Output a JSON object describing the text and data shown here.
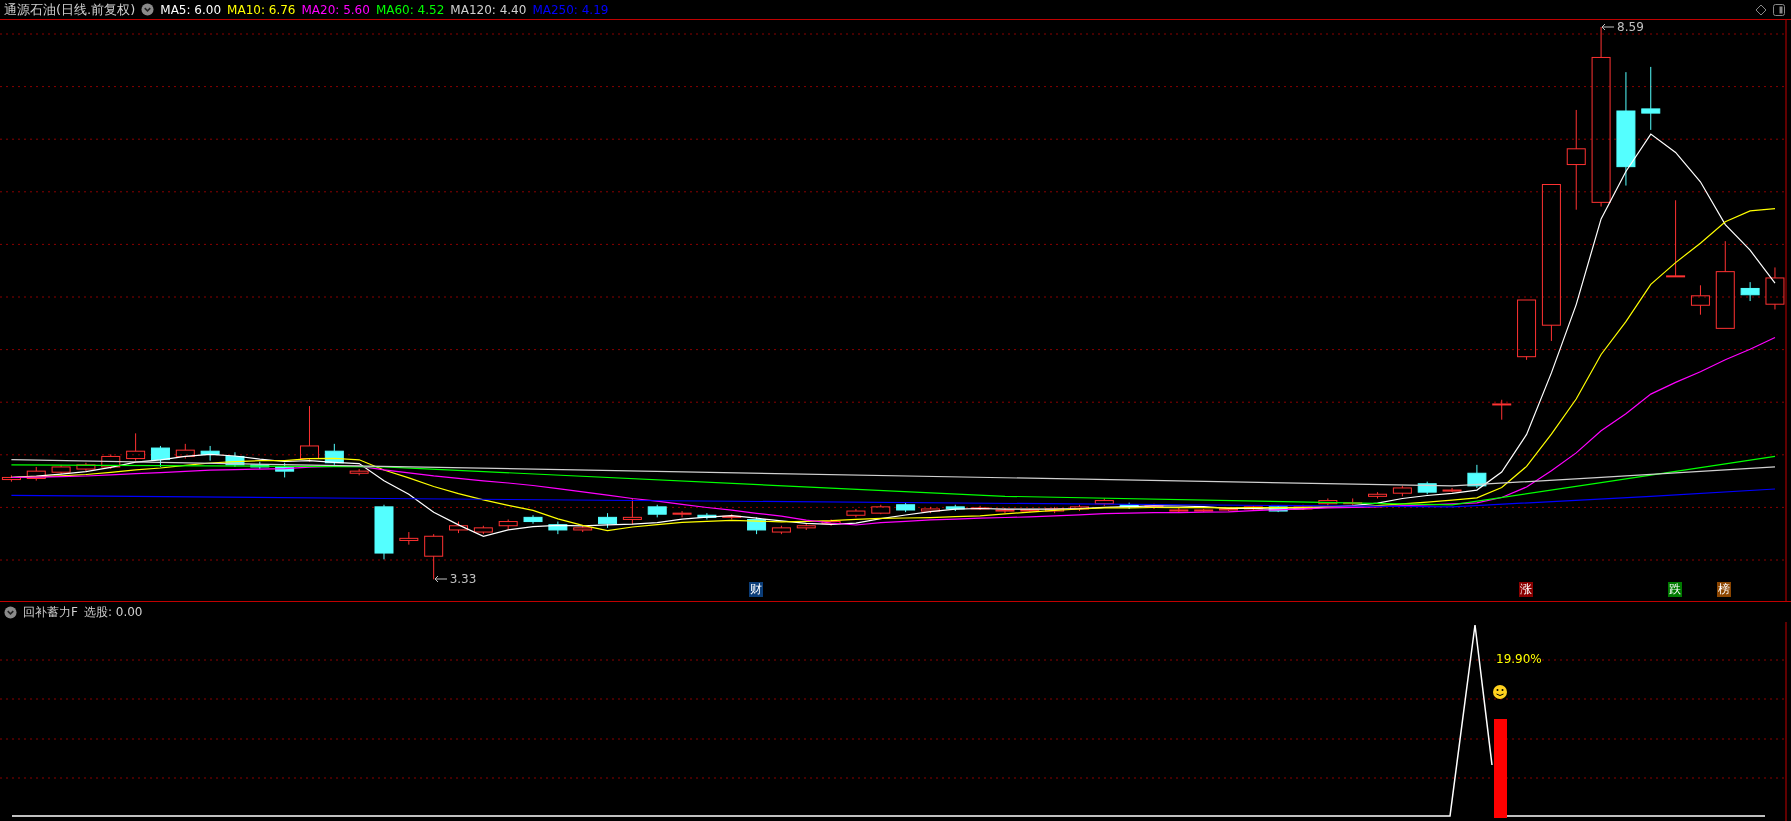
{
  "header": {
    "title": "通源石油(日线.前复权)",
    "ma_legend": [
      {
        "label": "MA5: 6.00",
        "color": "#ffffff"
      },
      {
        "label": "MA10: 6.76",
        "color": "#ffff00"
      },
      {
        "label": "MA20: 5.60",
        "color": "#ff00ff"
      },
      {
        "label": "MA60: 4.52",
        "color": "#00ff00"
      },
      {
        "label": "MA120: 4.40",
        "color": "#d0d0d0"
      },
      {
        "label": "MA250: 4.19",
        "color": "#0000ff"
      }
    ]
  },
  "main_chart": {
    "high_label": "8.59",
    "low_label": "3.33",
    "events": [
      {
        "label": "财",
        "color": "#0b3d78"
      },
      {
        "label": "涨",
        "color": "#8b0000"
      },
      {
        "label": "跌",
        "color": "#007a00"
      },
      {
        "label": "榜",
        "color": "#8b4500"
      }
    ]
  },
  "indicator": {
    "name": "回补蓄力F",
    "reading": "选股: 0.00",
    "value_label": "19.90%"
  }
}
